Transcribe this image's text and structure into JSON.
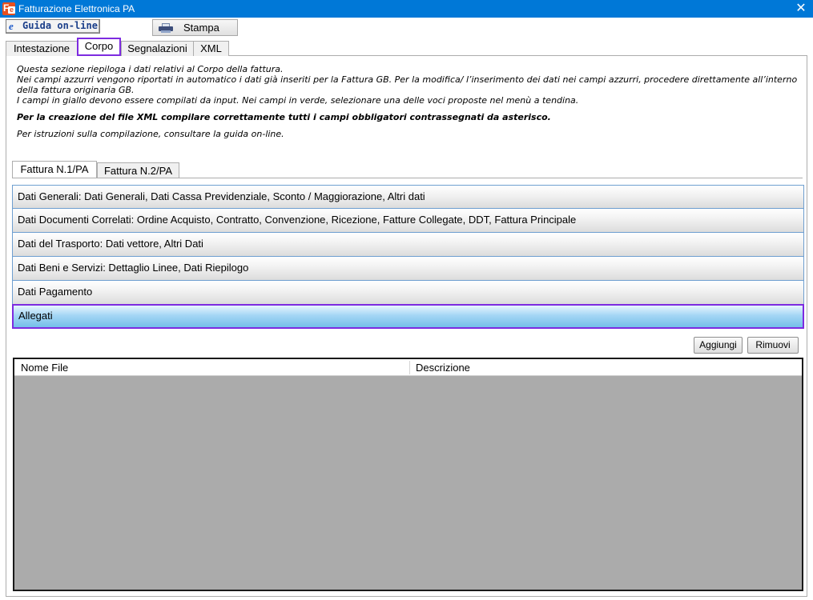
{
  "window": {
    "title": "Fatturazione Elettronica PA",
    "icon_letters": "Fe"
  },
  "toolbar": {
    "guida_label": "Guida on-line",
    "stampa_label": "Stampa"
  },
  "tabs": [
    {
      "label": "Intestazione",
      "active": false
    },
    {
      "label": "Corpo",
      "active": true
    },
    {
      "label": "Segnalazioni",
      "active": false
    },
    {
      "label": "XML",
      "active": false
    }
  ],
  "info": {
    "line1": "Questa sezione riepiloga i dati relativi al Corpo della fattura.",
    "line2": "Nei campi azzurri vengono riportati in automatico i dati già inseriti per la Fattura GB. Per la modifica/ l’inserimento dei dati nei campi azzurri, procedere direttamente all’interno della fattura originaria GB.",
    "line3": "I campi in giallo devono essere compilati da input. Nei campi in verde, selezionare una delle voci proposte nel menù a tendina.",
    "bold_line": "Per la creazione del file XML compilare correttamente tutti i campi obbligatori contrassegnati da asterisco.",
    "guide_line": "Per istruzioni sulla compilazione, consultare la guida on-line."
  },
  "invoice_tabs": [
    {
      "label": "Fattura N.1/PA",
      "active": true
    },
    {
      "label": "Fattura N.2/PA",
      "active": false
    }
  ],
  "sections": [
    {
      "label": "Dati Generali: Dati Generali, Dati Cassa Previdenziale, Sconto / Maggiorazione, Altri dati"
    },
    {
      "label": "Dati Documenti Correlati: Ordine Acquisto, Contratto, Convenzione, Ricezione, Fatture Collegate, DDT, Fattura Principale"
    },
    {
      "label": "Dati del Trasporto: Dati vettore, Altri Dati"
    },
    {
      "label": "Dati Beni e Servizi: Dettaglio Linee, Dati Riepilogo"
    },
    {
      "label": "Dati Pagamento"
    },
    {
      "label": "Allegati",
      "active": true
    }
  ],
  "allegati": {
    "add_label": "Aggiungi",
    "remove_label": "Rimuovi",
    "columns": [
      "Nome File",
      "Descrizione"
    ]
  }
}
